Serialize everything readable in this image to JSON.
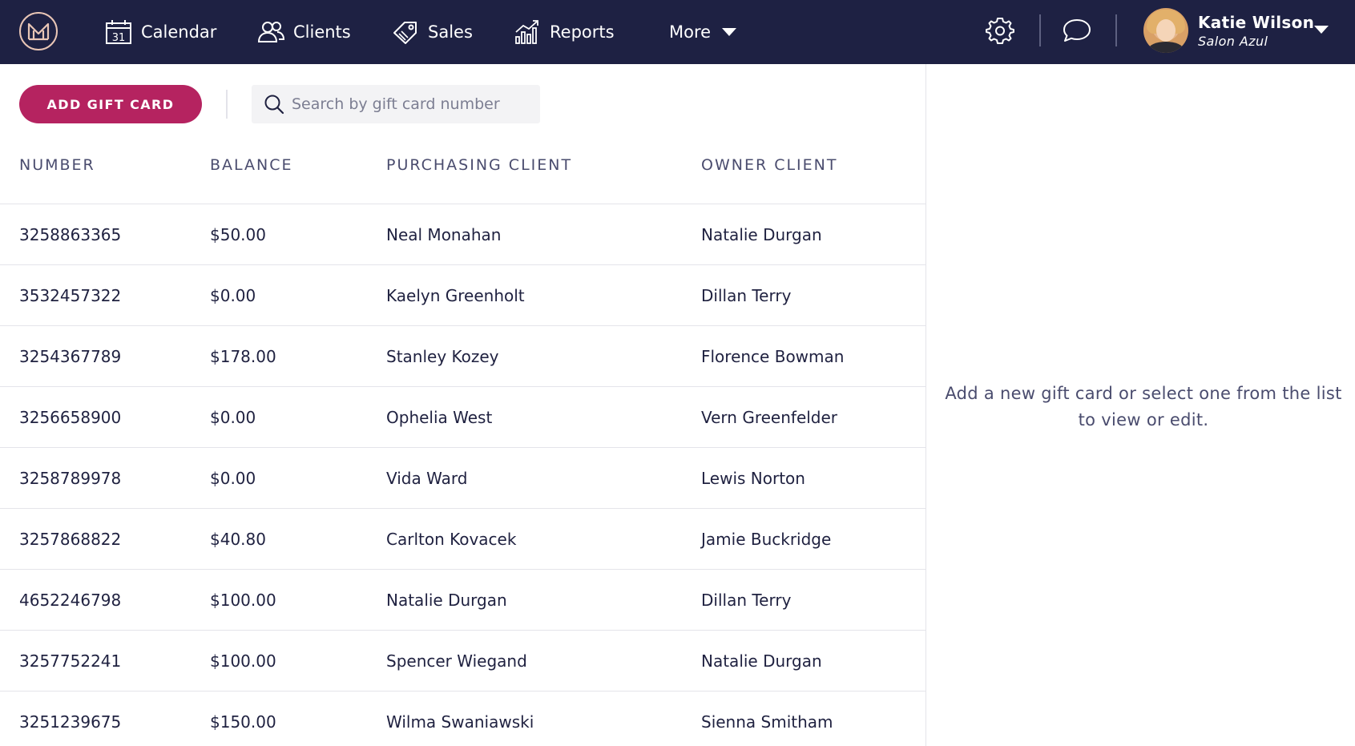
{
  "nav": {
    "calendar": "Calendar",
    "calendar_day": "31",
    "clients": "Clients",
    "sales": "Sales",
    "reports": "Reports",
    "more": "More"
  },
  "user": {
    "name": "Katie Wilson",
    "salon": "Salon Azul"
  },
  "toolbar": {
    "add_label": "ADD GIFT CARD",
    "search_placeholder": "Search by gift card number"
  },
  "table": {
    "headers": [
      "NUMBER",
      "BALANCE",
      "PURCHASING CLIENT",
      "OWNER CLIENT"
    ],
    "rows": [
      [
        "3258863365",
        "$50.00",
        "Neal Monahan",
        "Natalie Durgan"
      ],
      [
        "3532457322",
        "$0.00",
        "Kaelyn Greenholt",
        "Dillan Terry"
      ],
      [
        "3254367789",
        "$178.00",
        "Stanley Kozey",
        "Florence Bowman"
      ],
      [
        "3256658900",
        "$0.00",
        "Ophelia West",
        "Vern Greenfelder"
      ],
      [
        "3258789978",
        "$0.00",
        "Vida Ward",
        "Lewis Norton"
      ],
      [
        "3257868822",
        "$40.80",
        "Carlton Kovacek",
        "Jamie Buckridge"
      ],
      [
        "4652246798",
        "$100.00",
        "Natalie Durgan",
        "Dillan Terry"
      ],
      [
        "3257752241",
        "$100.00",
        "Spencer Wiegand",
        "Natalie Durgan"
      ],
      [
        "3251239675",
        "$150.00",
        "Wilma Swaniawski",
        "Sienna Smitham"
      ]
    ]
  },
  "detail": {
    "empty_message": "Add a new gift card or select one from the list to view or edit."
  },
  "colors": {
    "nav_bg": "#1e2143",
    "accent": "#b52360",
    "text": "#1f2140",
    "muted": "#4a4c6e"
  },
  "icons": [
    "logo-icon",
    "calendar-icon",
    "clients-icon",
    "sales-tag-icon",
    "reports-chart-icon",
    "chevron-down-icon",
    "gear-icon",
    "chat-icon",
    "search-icon"
  ]
}
